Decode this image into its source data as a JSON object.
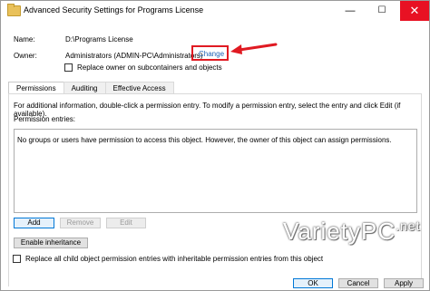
{
  "window": {
    "title": "Advanced Security Settings for Programs License",
    "controls": {
      "minimize": "—",
      "maximize": "☐",
      "close": "✕"
    }
  },
  "properties": {
    "name_label": "Name:",
    "name_value": "D:\\Programs License",
    "owner_label": "Owner:",
    "owner_value": "Administrators (ADMIN-PC\\Administrators)",
    "change_link": "Change",
    "replace_owner_label": "Replace owner on subcontainers and objects",
    "replace_owner_checked": false
  },
  "tabs": [
    {
      "label": "Permissions",
      "active": true
    },
    {
      "label": "Auditing",
      "active": false
    },
    {
      "label": "Effective Access",
      "active": false
    }
  ],
  "permissions": {
    "info": "For additional information, double-click a permission entry. To modify a permission entry, select the entry and click Edit (if available).",
    "entries_label": "Permission entries:",
    "entries_message": "No groups or users have permission to access this object. However, the owner of this object can assign permissions.",
    "add_label": "Add",
    "remove_label": "Remove",
    "edit_label": "Edit",
    "enable_inheritance_label": "Enable inheritance",
    "replace_all_label": "Replace all child object permission entries with inheritable permission entries from this object",
    "replace_all_checked": false
  },
  "footer": {
    "ok_label": "OK",
    "cancel_label": "Cancel",
    "apply_label": "Apply"
  },
  "watermark": {
    "main": "VarietyPC",
    "suffix": ".net"
  },
  "colors": {
    "highlight_red": "#e01a22",
    "link_blue": "#1a5fb4",
    "close_red": "#e81123"
  }
}
